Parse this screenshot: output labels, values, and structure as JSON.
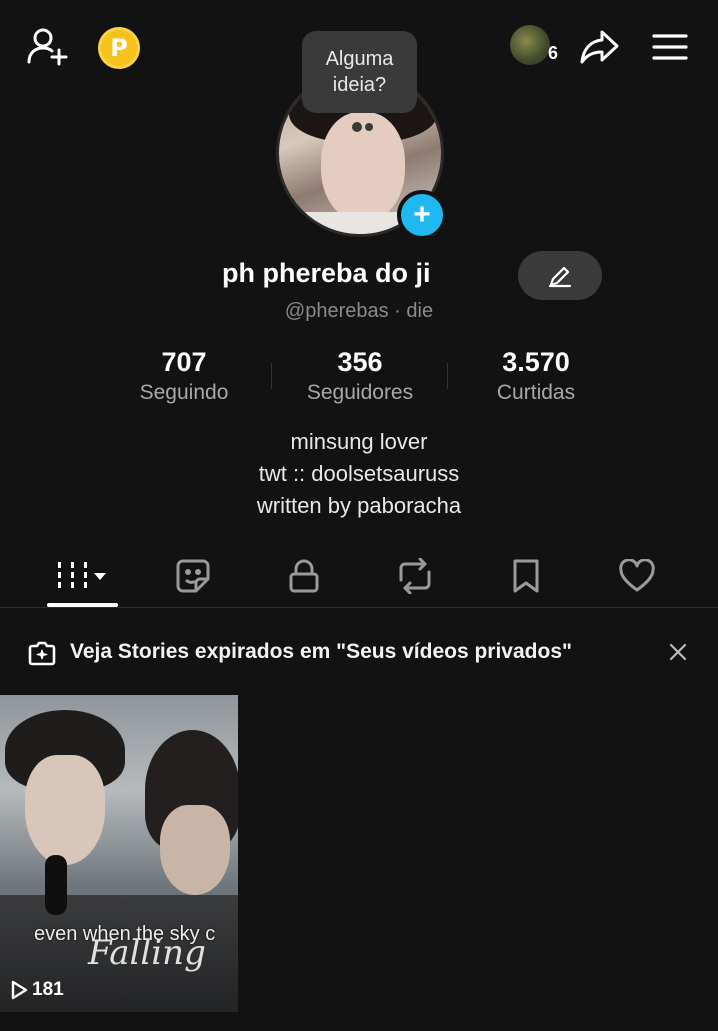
{
  "header": {
    "coin_label": "P",
    "friends_count": "6"
  },
  "profile": {
    "bubble_line1": "Alguma",
    "bubble_line2": "ideia?",
    "display_name": "ph phereba do ji",
    "username": "@pherebas · die",
    "stats": [
      {
        "value": "707",
        "label": "Seguindo"
      },
      {
        "value": "356",
        "label": "Seguidores"
      },
      {
        "value": "3.570",
        "label": "Curtidas"
      }
    ],
    "bio": [
      "minsung lover",
      "twt :: doolsetsauruss",
      "written by paboracha"
    ]
  },
  "banner": {
    "text": "Veja Stories expirados em \"Seus vídeos privados\""
  },
  "videos": [
    {
      "caption": "even when the sky c",
      "script_text": "Falling",
      "views": "181"
    }
  ],
  "colors": {
    "background": "#121212",
    "accent_blue": "#20b8f0",
    "coin_gold": "#f6c21c"
  }
}
